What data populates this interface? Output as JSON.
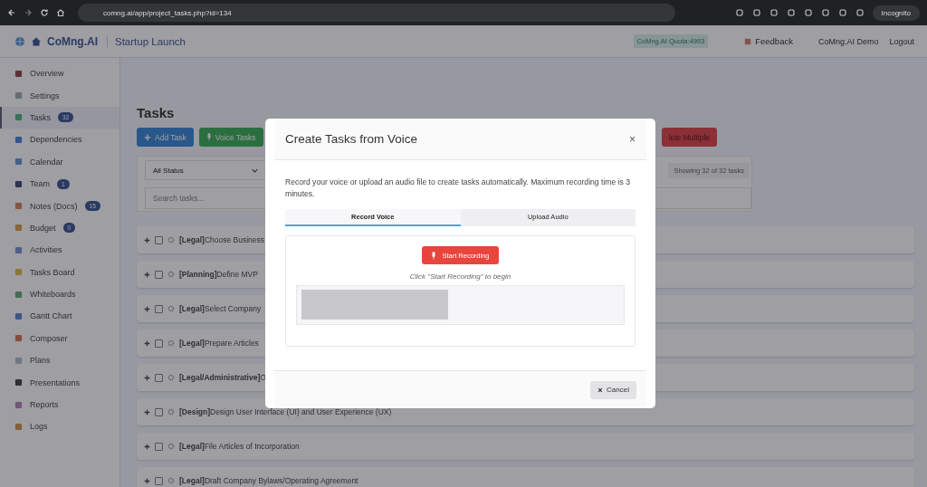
{
  "browser": {
    "url": "comng.ai/app/project_tasks.php?id=134",
    "profile": "Incognito"
  },
  "header": {
    "brand": "CoMng.AI",
    "project": "Startup Launch",
    "quota": "CoMng.AI Quota:4993",
    "feedback": "Feedback",
    "user": "CoMng.AI Demo",
    "logout": "Logout"
  },
  "sidebar": {
    "items": [
      {
        "label": "Overview",
        "selected": false
      },
      {
        "label": "Settings",
        "selected": false
      },
      {
        "label": "Tasks",
        "selected": true,
        "badge": "32"
      },
      {
        "label": "Dependencies",
        "selected": false
      },
      {
        "label": "Calendar",
        "selected": false
      },
      {
        "label": "Team",
        "selected": false,
        "badge": "1"
      },
      {
        "label": "Notes (Docs)",
        "selected": false,
        "badge": "15"
      },
      {
        "label": "Budget",
        "selected": false,
        "badge": "0"
      },
      {
        "label": "Activities",
        "selected": false
      },
      {
        "label": "Tasks Board",
        "selected": false
      },
      {
        "label": "Whiteboards",
        "selected": false
      },
      {
        "label": "Gantt Chart",
        "selected": false
      },
      {
        "label": "Composer",
        "selected": false
      },
      {
        "label": "Plans",
        "selected": false
      },
      {
        "label": "Presentations",
        "selected": false
      },
      {
        "label": "Reports",
        "selected": false
      },
      {
        "label": "Logs",
        "selected": false
      }
    ]
  },
  "main": {
    "title": "Tasks",
    "buttons": [
      {
        "label": "Add Task",
        "kind": "add"
      },
      {
        "label": "Voice Tasks",
        "kind": "voice"
      },
      {
        "label": "lete Multiple",
        "kind": "delete"
      }
    ],
    "status_filter": "All Status",
    "search": {
      "placeholder": "Search tasks..."
    },
    "count": "Showing 32 of 32 tasks",
    "tasks": [
      {
        "category": "[Legal]",
        "title": "Choose Business",
        "checked": false
      },
      {
        "category": "[Planning]",
        "title": "Define MVP",
        "checked": false
      },
      {
        "category": "[Legal]",
        "title": "Select Company",
        "checked": false
      },
      {
        "category": "[Legal]",
        "title": "Prepare Articles",
        "checked": false
      },
      {
        "category": "[Legal/Administrative]",
        "title": "O",
        "checked": false
      },
      {
        "category": "[Design]",
        "title": "Design User Interface (UI) and User Experience (UX)",
        "checked": false
      },
      {
        "category": "[Legal]",
        "title": "File Articles of Incorporation",
        "checked": false
      },
      {
        "category": "[Legal]",
        "title": "Draft Company Bylaws/Operating Agreement",
        "checked": false
      }
    ]
  },
  "modal": {
    "title": "Create Tasks from Voice",
    "close": "×",
    "description": "Record your voice or upload an audio file to create tasks automatically. Maximum recording time is 3 minutes.",
    "tabs": [
      {
        "label": "Record Voice",
        "selected": true
      },
      {
        "label": "Upload Audio",
        "selected": false
      }
    ],
    "record_button": "Start Recording",
    "hint": "Click \"Start Recording\" to begin",
    "cancel": "Cancel"
  }
}
